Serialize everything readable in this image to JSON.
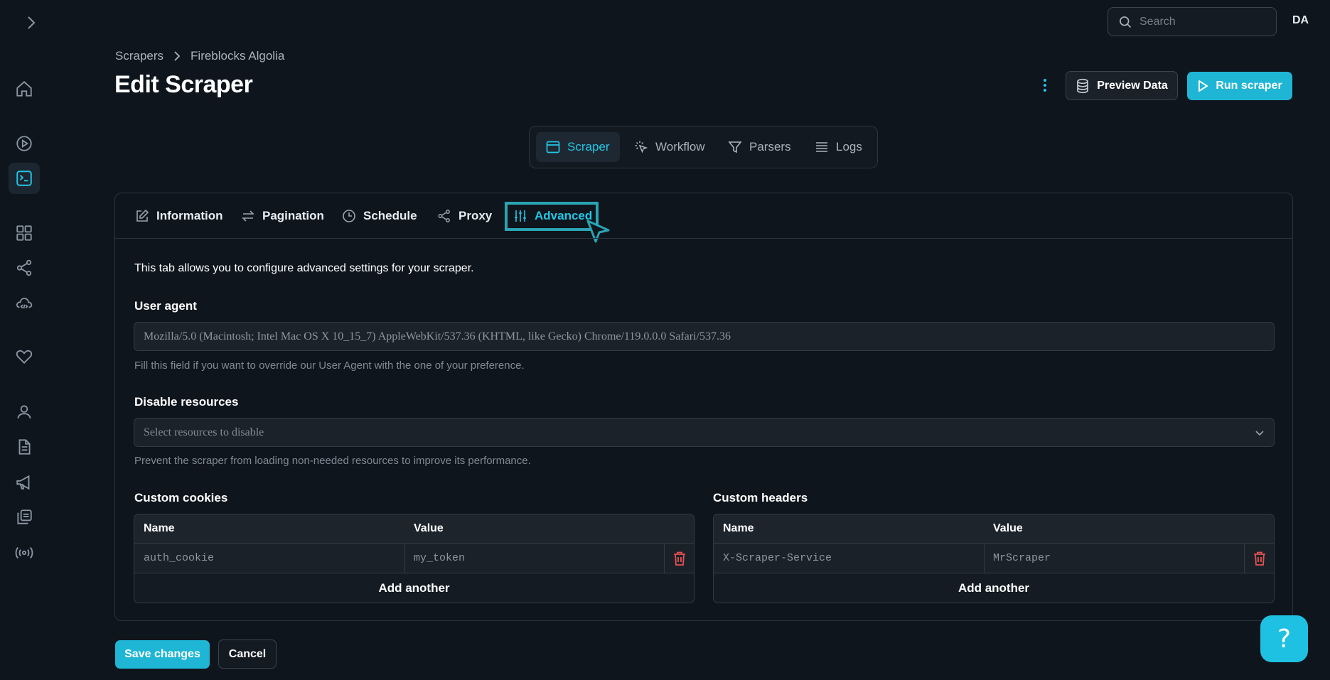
{
  "sidebar": {
    "expand_icon": "chevron-right-icon",
    "items": [
      {
        "name": "home",
        "icon": "home-icon"
      },
      {
        "name": "play",
        "icon": "play-circle-icon"
      },
      {
        "name": "scrapers",
        "icon": "terminal-icon",
        "active": true
      },
      {
        "name": "dashboard",
        "icon": "grid-icon"
      },
      {
        "name": "share",
        "icon": "share-icon"
      },
      {
        "name": "cloud-code",
        "icon": "cloud-code-icon"
      },
      {
        "name": "favorites",
        "icon": "heart-icon"
      },
      {
        "name": "account",
        "icon": "user-icon"
      },
      {
        "name": "docs",
        "icon": "document-icon"
      },
      {
        "name": "announcements",
        "icon": "megaphone-icon"
      },
      {
        "name": "copies",
        "icon": "copy-icon"
      },
      {
        "name": "broadcast",
        "icon": "broadcast-icon"
      }
    ]
  },
  "topbar": {
    "search_placeholder": "Search",
    "avatar_initials": "DA"
  },
  "breadcrumb": {
    "root": "Scrapers",
    "current": "Fireblocks Algolia"
  },
  "page": {
    "title": "Edit Scraper"
  },
  "actions": {
    "preview_label": "Preview Data",
    "run_label": "Run scraper"
  },
  "top_tabs": {
    "scraper": "Scraper",
    "workflow": "Workflow",
    "parsers": "Parsers",
    "logs": "Logs",
    "active": "Scraper"
  },
  "panel_tabs": {
    "information": "Information",
    "pagination": "Pagination",
    "schedule": "Schedule",
    "proxy": "Proxy",
    "advanced": "Advanced",
    "active": "Advanced"
  },
  "advanced": {
    "intro": "This tab allows you to configure advanced settings for your scraper.",
    "user_agent": {
      "label": "User agent",
      "value": "Mozilla/5.0 (Macintosh; Intel Mac OS X 10_15_7) AppleWebKit/537.36 (KHTML, like Gecko) Chrome/119.0.0.0 Safari/537.36",
      "help": "Fill this field if you want to override our User Agent with the one of your preference."
    },
    "disable_resources": {
      "label": "Disable resources",
      "placeholder": "Select resources to disable",
      "help": "Prevent the scraper from loading non-needed resources to improve its performance."
    },
    "custom_cookies": {
      "label": "Custom cookies",
      "col_name": "Name",
      "col_value": "Value",
      "rows": [
        {
          "name": "auth_cookie",
          "value": "my_token"
        }
      ],
      "add_label": "Add another"
    },
    "custom_headers": {
      "label": "Custom headers",
      "col_name": "Name",
      "col_value": "Value",
      "rows": [
        {
          "name": "X-Scraper-Service",
          "value": "MrScraper"
        }
      ],
      "add_label": "Add another"
    }
  },
  "footer": {
    "save_label": "Save changes",
    "cancel_label": "Cancel",
    "help_label": "?"
  },
  "colors": {
    "accent": "#1fb6d6",
    "background": "#0f151d",
    "danger": "#e65151"
  }
}
